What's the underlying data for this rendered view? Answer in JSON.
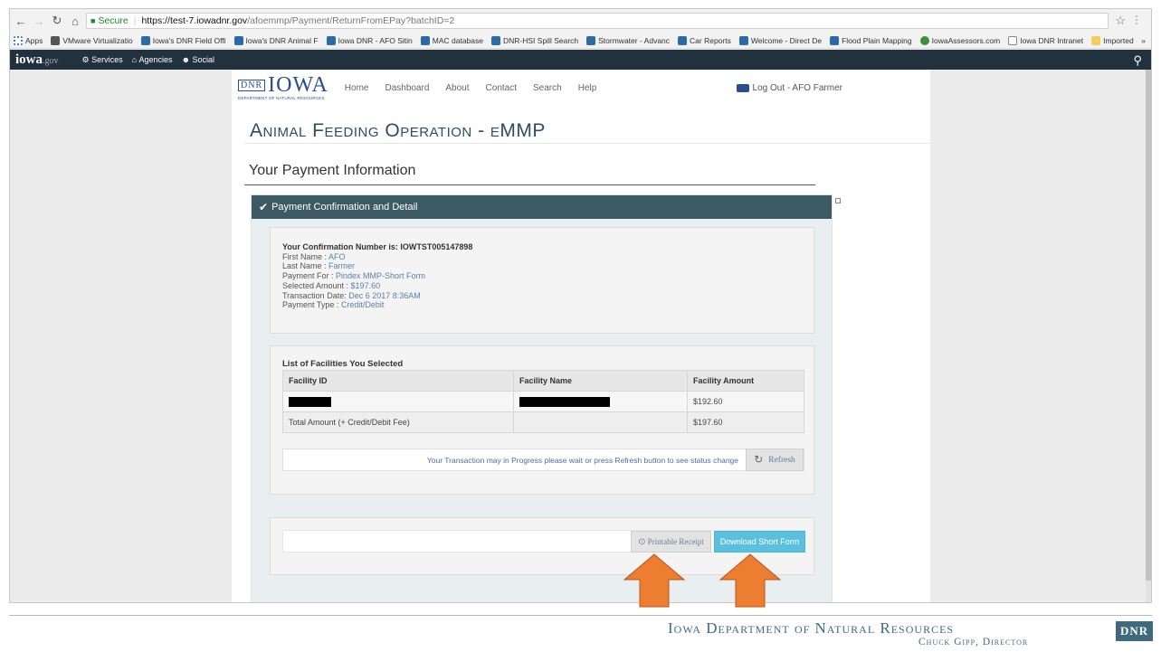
{
  "browser": {
    "url_secure": "Secure",
    "url_host": "https://test-7.iowadnr.gov",
    "url_path": "/afoemmp/Payment/ReturnFromEPay?batchID=2",
    "bookmarks": [
      {
        "label": "Apps",
        "icon": "apps-grid-icon"
      },
      {
        "label": "VMware Virtualizatio",
        "icon": "vmware-icon"
      },
      {
        "label": "Iowa's DNR Field Offi",
        "icon": "dnr-icon"
      },
      {
        "label": "Iowa's DNR Animal F",
        "icon": "dnr-icon"
      },
      {
        "label": "Iowa DNR - AFO Sitin",
        "icon": "dnr-icon"
      },
      {
        "label": "MAC database",
        "icon": "dnr-icon"
      },
      {
        "label": "DNR-HSI Spill Search",
        "icon": "dnr-icon"
      },
      {
        "label": "Stormwater - Advanc",
        "icon": "dnr-icon"
      },
      {
        "label": "Car Reports",
        "icon": "dnr-icon"
      },
      {
        "label": "Welcome - Direct De",
        "icon": "dnr-icon"
      },
      {
        "label": "Flood Plain Mapping",
        "icon": "dnr-icon"
      },
      {
        "label": "IowaAssessors.com",
        "icon": "globe-icon"
      },
      {
        "label": "Iowa DNR Intranet",
        "icon": "page-icon"
      },
      {
        "label": "Imported",
        "icon": "folder-icon"
      }
    ],
    "bm_more": "»"
  },
  "gov_bar": {
    "logo": "iowa",
    "logo_suffix": ".gov",
    "services": "Services",
    "agencies": "Agencies",
    "social": "Social"
  },
  "site_nav": {
    "logo_main": "IOWA",
    "logo_box": "DNR",
    "logo_sub": "DEPARTMENT OF NATURAL RESOURCES",
    "links": [
      "Home",
      "Dashboard",
      "About",
      "Contact",
      "Search",
      "Help"
    ],
    "logout": "Log Out - AFO Farmer"
  },
  "page": {
    "title": "Animal Feeding Operation - eMMP",
    "subhead": "Your Payment Information",
    "panel_title": "Payment Confirmation and Detail"
  },
  "confirmation": {
    "number_label": "Your Confirmation Number is: IOWTST005147898",
    "first_name_label": "First Name : ",
    "first_name": "AFO",
    "last_name_label": "Last Name : ",
    "last_name": "Farmer",
    "payment_for_label": "Payment For : ",
    "payment_for": "Pindex MMP-Short Form",
    "amount_label": "Selected Amount : ",
    "amount": "$197.60",
    "date_label": "Transaction Date: ",
    "date": "Dec 6 2017 8:36AM",
    "type_label": "Payment Type : ",
    "type": "Credit/Debit"
  },
  "facilities": {
    "title": "List of Facilities You Selected",
    "headers": [
      "Facility ID",
      "Facility Name",
      "Facility Amount"
    ],
    "row_amount": "$192.60",
    "total_label": "Total Amount (+ Credit/Debit Fee)",
    "total_amount": "$197.60",
    "status": "Your Transaction may in Progress please wait or press Refresh button to see status change",
    "refresh": "Refresh"
  },
  "actions": {
    "printable": "Printable  Receipt",
    "download": "Download Short Form"
  },
  "footer": {
    "org": "Iowa Department of Natural Resources",
    "director": "Chuck Gipp, Director",
    "logo": "DNR"
  },
  "colors": {
    "panel_header": "#3d5a64",
    "accent_button": "#5bc0de",
    "arrow": "#ed7d31"
  }
}
